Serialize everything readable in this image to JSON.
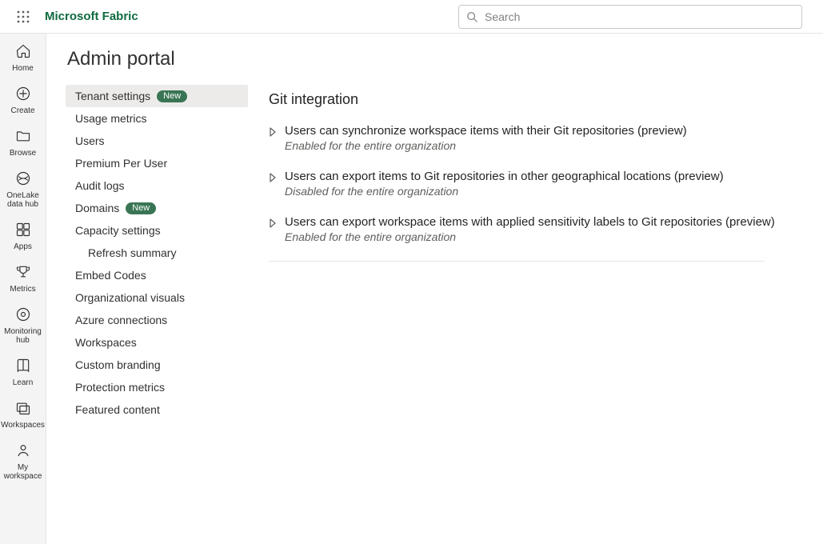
{
  "header": {
    "brand": "Microsoft Fabric",
    "search_placeholder": "Search"
  },
  "rail": [
    {
      "id": "home",
      "label": "Home"
    },
    {
      "id": "create",
      "label": "Create"
    },
    {
      "id": "browse",
      "label": "Browse"
    },
    {
      "id": "onelake",
      "label": "OneLake data hub"
    },
    {
      "id": "apps",
      "label": "Apps"
    },
    {
      "id": "metrics",
      "label": "Metrics"
    },
    {
      "id": "monitoring",
      "label": "Monitoring hub"
    },
    {
      "id": "learn",
      "label": "Learn"
    },
    {
      "id": "workspaces",
      "label": "Workspaces"
    },
    {
      "id": "myworkspace",
      "label": "My workspace"
    }
  ],
  "page": {
    "title": "Admin portal"
  },
  "badges": {
    "new": "New"
  },
  "subnav": [
    {
      "label": "Tenant settings",
      "badge": "new",
      "active": true
    },
    {
      "label": "Usage metrics"
    },
    {
      "label": "Users"
    },
    {
      "label": "Premium Per User"
    },
    {
      "label": "Audit logs"
    },
    {
      "label": "Domains",
      "badge": "new"
    },
    {
      "label": "Capacity settings"
    },
    {
      "label": "Refresh summary",
      "indent": true
    },
    {
      "label": "Embed Codes"
    },
    {
      "label": "Organizational visuals"
    },
    {
      "label": "Azure connections"
    },
    {
      "label": "Workspaces"
    },
    {
      "label": "Custom branding"
    },
    {
      "label": "Protection metrics"
    },
    {
      "label": "Featured content"
    }
  ],
  "panel": {
    "title": "Git integration",
    "settings": [
      {
        "title": "Users can synchronize workspace items with their Git repositories (preview)",
        "status": "Enabled for the entire organization"
      },
      {
        "title": "Users can export items to Git repositories in other geographical locations (preview)",
        "status": "Disabled for the entire organization"
      },
      {
        "title": "Users can export workspace items with applied sensitivity labels to Git repositories (preview)",
        "status": "Enabled for the entire organization"
      }
    ]
  }
}
